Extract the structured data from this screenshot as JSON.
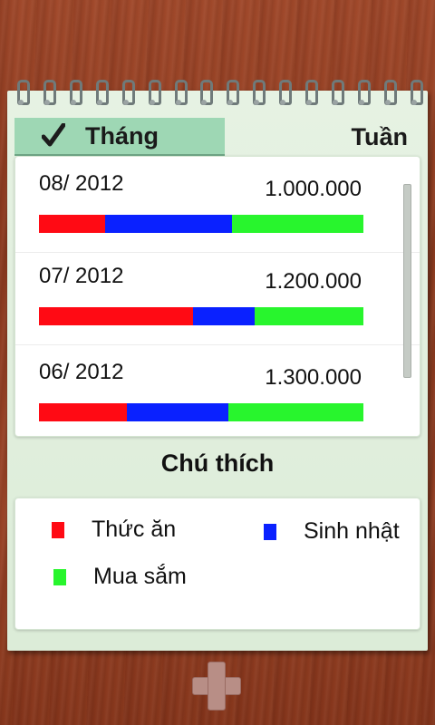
{
  "tabs": {
    "month_label": "Tháng",
    "week_label": "Tuần",
    "selected": "month",
    "check_icon": "check-icon"
  },
  "months": [
    {
      "label": "08/ 2012",
      "amount": "1.000.000",
      "breakdown": [
        {
          "category": "Thức ăn",
          "fraction": 0.205,
          "color": "#ff0a14"
        },
        {
          "category": "Sinh nhật",
          "fraction": 0.39,
          "color": "#0a21ff"
        },
        {
          "category": "Mua sắm",
          "fraction": 0.405,
          "color": "#28f52d"
        }
      ]
    },
    {
      "label": "07/ 2012",
      "amount": "1.200.000",
      "breakdown": [
        {
          "category": "Thức ăn",
          "fraction": 0.475,
          "color": "#ff0a14"
        },
        {
          "category": "Sinh nhật",
          "fraction": 0.19,
          "color": "#0a21ff"
        },
        {
          "category": "Mua sắm",
          "fraction": 0.335,
          "color": "#28f52d"
        }
      ]
    },
    {
      "label": "06/ 2012",
      "amount": "1.300.000",
      "breakdown": [
        {
          "category": "Thức ăn",
          "fraction": 0.27,
          "color": "#ff0a14"
        },
        {
          "category": "Sinh nhật",
          "fraction": 0.315,
          "color": "#0a21ff"
        },
        {
          "category": "Mua sắm",
          "fraction": 0.415,
          "color": "#28f52d"
        }
      ]
    }
  ],
  "legend": {
    "title": "Chú thích",
    "items": [
      {
        "label": "Thức ăn",
        "color": "#ff0a14"
      },
      {
        "label": "Sinh nhật",
        "color": "#0a21ff"
      },
      {
        "label": "Mua sắm",
        "color": "#28f52d"
      }
    ]
  },
  "add_button": {
    "icon": "plus-icon"
  }
}
